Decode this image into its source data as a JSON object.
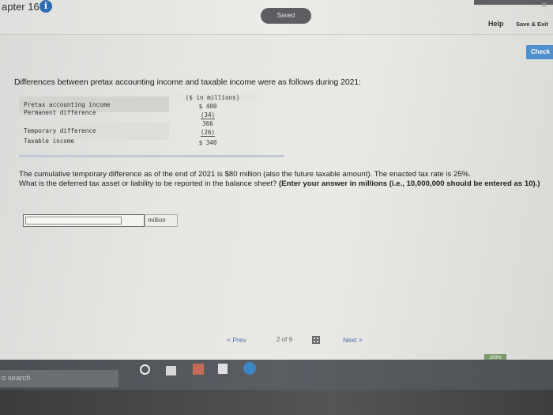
{
  "header": {
    "chapter": "apter 16",
    "info": "i",
    "saved": "Saved",
    "help": "Help",
    "save_exit": "Save & Exit",
    "check": "Check"
  },
  "problem": {
    "intro": "Differences between pretax accounting income and taxable income were as follows during 2021:",
    "table": {
      "header": "($ in millions)",
      "rows": [
        {
          "label": "Pretax accounting income",
          "value": "$ 400"
        },
        {
          "label": "Permanent difference",
          "value": "(34)"
        },
        {
          "label": "",
          "value": "366"
        },
        {
          "label": "Temporary difference",
          "value": "(26)"
        },
        {
          "label": "Taxable income",
          "value": "$ 340"
        }
      ]
    },
    "question_line1": "The cumulative temporary difference as of the end of 2021 is $80 million (also the future taxable amount). The enacted tax rate is 25%.",
    "question_line2": "What is the deferred tax asset or liability to be reported in the balance sheet?",
    "question_instruction": "(Enter your answer in millions (i.e., 10,000,000 should be entered as 10).)",
    "answer_value": "",
    "unit": "million"
  },
  "pager": {
    "prev": "< Prev",
    "page": "2 of 9",
    "next": "Next >"
  },
  "taskbar": {
    "search": "o search",
    "zoom": "100%"
  }
}
